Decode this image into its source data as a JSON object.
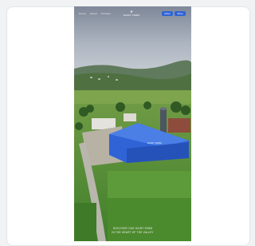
{
  "preview": {
    "nav": {
      "links": [
        "Home",
        "About",
        "Contact"
      ],
      "logo_mark": "❦",
      "logo_text": "DAIRY FARM",
      "buttons": [
        "Order",
        "Shop"
      ]
    },
    "barn_sign": "DAIRY FARM",
    "caption_lines": [
      "DISCOVER OUR DAIRY FARM",
      "IN THE HEART OF THE VALLEY"
    ]
  },
  "colors": {
    "sky": "#aab4c2",
    "barn_blue": "#2f63d6",
    "field_green": "#4f8a32",
    "accent_button": "#2f63d6"
  }
}
